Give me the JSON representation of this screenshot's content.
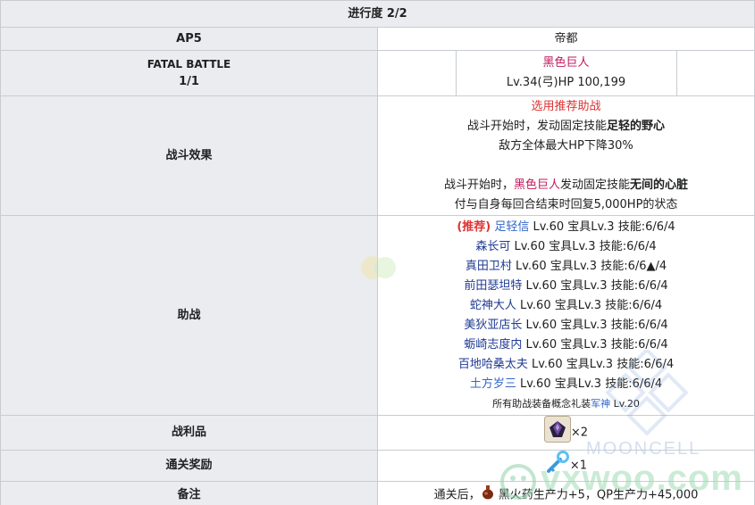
{
  "header": {
    "progress": "进行度 2/2"
  },
  "rows": {
    "ap": {
      "label": "AP5",
      "value": "帝都"
    },
    "battle": {
      "label_line1": "FATAL BATTLE",
      "label_line2": "1/1",
      "boss_name": "黑色巨人",
      "boss_stats": "Lv.34(弓)HP 100,199"
    },
    "effect": {
      "label": "战斗效果",
      "line1": "选用推荐助战",
      "line2_prefix": "战斗开始时，发动固定技能",
      "line2_skill": "足轻的野心",
      "line3": "敌方全体最大HP下降30%",
      "line4_prefix": "战斗开始时，",
      "line4_name": "黑色巨人",
      "line4_mid": "发动固定技能",
      "line4_skill": "无间的心脏",
      "line5": "付与自身每回合结束时回复5,000HP的状态"
    },
    "support": {
      "label": "助战",
      "recommend_tag": "(推荐)",
      "members": [
        {
          "name": "足轻信",
          "stats": "Lv.60 宝具Lv.3 技能:6/6/4"
        },
        {
          "name": "森长可",
          "stats": "Lv.60 宝具Lv.3 技能:6/6/4"
        },
        {
          "name": "真田卫村",
          "stats": "Lv.60 宝具Lv.3 技能:6/6▲/4"
        },
        {
          "name": "前田瑟坦特",
          "stats": "Lv.60 宝具Lv.3 技能:6/6/4"
        },
        {
          "name": "蛇神大人",
          "stats": "Lv.60 宝具Lv.3 技能:6/6/4"
        },
        {
          "name": "美狄亚店长",
          "stats": "Lv.60 宝具Lv.3 技能:6/6/4"
        },
        {
          "name": "蛎崎志度内",
          "stats": "Lv.60 宝具Lv.3 技能:6/6/4"
        },
        {
          "name": "百地哈桑太夫",
          "stats": "Lv.60 宝具Lv.3 技能:6/6/4"
        },
        {
          "name": "土方岁三",
          "stats": "Lv.60 宝具Lv.3 技能:6/6/4"
        }
      ],
      "note_prefix": "所有助战装备概念礼装",
      "note_link": "军神",
      "note_suffix": " Lv.20"
    },
    "loot": {
      "label": "战利品",
      "count": "×2",
      "icon": "dark-crystal-icon"
    },
    "reward": {
      "label": "通关奖励",
      "count": "×1",
      "icon": "blue-key-icon"
    },
    "remark": {
      "label": "备注",
      "prefix": "通关后，",
      "text": " 黑火药生产力+5，QP生产力+45,000",
      "icon": "gunpowder-icon"
    }
  },
  "watermark": {
    "brand": "MOONCELL",
    "site": "vxwoo.com"
  }
}
